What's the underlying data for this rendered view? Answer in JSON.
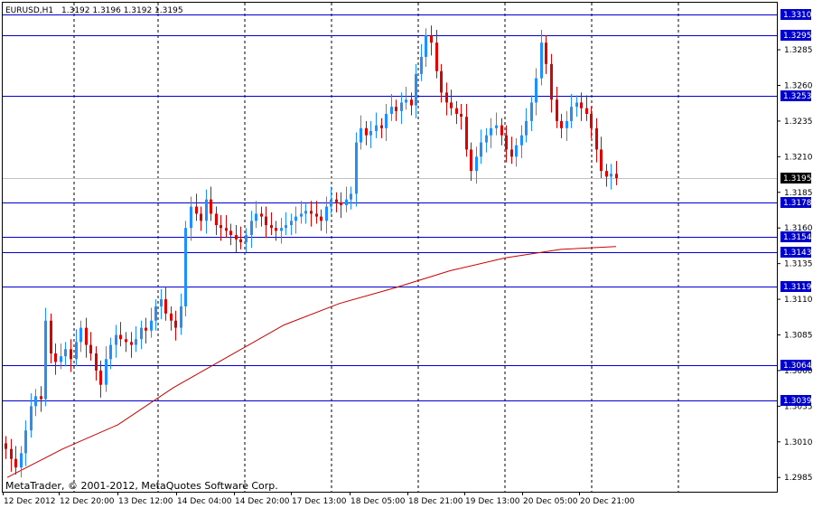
{
  "header": {
    "symbol": "EURUSD,H1",
    "ohlc": "1.3192 1.3196 1.3192 1.3195"
  },
  "watermark": "MetaTrader, © 2001-2012, MetaQuotes Software Corp.",
  "colors": {
    "background": "#ffffff",
    "frame": "#000000",
    "bull_candle": "#1e90ff",
    "bear_candle": "#e00000",
    "hline": "#0000cc",
    "moving_average": "#cc0000",
    "grid_vertical": "#000000",
    "current_price_line": "#c0c0c0",
    "current_price_tag": "#000000"
  },
  "chart_data": {
    "type": "candlestick",
    "symbol": "EURUSD",
    "timeframe": "H1",
    "ylim": [
      1.2975,
      1.3318
    ],
    "yticks": [
      "1.3285",
      "1.3260",
      "1.3235",
      "1.3210",
      "1.3185",
      "1.3160",
      "1.3135",
      "1.3110",
      "1.3085",
      "1.3060",
      "1.3035",
      "1.3010",
      "1.2985"
    ],
    "xticks": [
      "12 Dec 2012",
      "12 Dec 20:00",
      "13 Dec 12:00",
      "14 Dec 04:00",
      "14 Dec 20:00",
      "17 Dec 13:00",
      "18 Dec 05:00",
      "18 Dec 21:00",
      "19 Dec 13:00",
      "20 Dec 05:00",
      "20 Dec 21:00"
    ],
    "horizontal_levels": [
      1.331,
      1.3295,
      1.3253,
      1.3178,
      1.3154,
      1.3143,
      1.3119,
      1.3064,
      1.3039
    ],
    "horizontal_level_labels": [
      "1.3310",
      "1.3295",
      "1.3253",
      "1.3178",
      "1.3154",
      "1.3143",
      "1.3119",
      "1.3064",
      "1.3039"
    ],
    "current_price": 1.3195,
    "current_price_label": "1.3195",
    "close_series": [
      1.3005,
      1.2998,
      1.2992,
      1.3002,
      1.3018,
      1.3035,
      1.3042,
      1.304,
      1.3095,
      1.3072,
      1.3066,
      1.307,
      1.3075,
      1.3068,
      1.308,
      1.309,
      1.3078,
      1.3072,
      1.306,
      1.305,
      1.3068,
      1.3078,
      1.3085,
      1.3082,
      1.308,
      1.3078,
      1.3082,
      1.309,
      1.3088,
      1.3095,
      1.3105,
      1.311,
      1.31,
      1.3095,
      1.309,
      1.3105,
      1.316,
      1.3175,
      1.317,
      1.3165,
      1.318,
      1.317,
      1.3162,
      1.316,
      1.3158,
      1.3155,
      1.3152,
      1.315,
      1.3155,
      1.3165,
      1.317,
      1.3168,
      1.3162,
      1.316,
      1.3158,
      1.316,
      1.3162,
      1.3165,
      1.3168,
      1.317,
      1.3172,
      1.317,
      1.3168,
      1.3165,
      1.3175,
      1.318,
      1.3178,
      1.3176,
      1.318,
      1.3184,
      1.322,
      1.323,
      1.3225,
      1.3228,
      1.3232,
      1.323,
      1.324,
      1.3245,
      1.3242,
      1.3248,
      1.325,
      1.3246,
      1.3268,
      1.328,
      1.3295,
      1.329,
      1.327,
      1.3255,
      1.3248,
      1.3244,
      1.324,
      1.3238,
      1.3215,
      1.32,
      1.321,
      1.322,
      1.3225,
      1.323,
      1.3232,
      1.3225,
      1.3215,
      1.321,
      1.3218,
      1.3225,
      1.3235,
      1.3248,
      1.3265,
      1.329,
      1.3275,
      1.325,
      1.3235,
      1.323,
      1.3235,
      1.3245,
      1.3248,
      1.3244,
      1.324,
      1.323,
      1.3215,
      1.32,
      1.3196,
      1.3198,
      1.3195
    ],
    "moving_average": [
      1.2985,
      1.3005,
      1.3022,
      1.3048,
      1.307,
      1.3092,
      1.3107,
      1.3118,
      1.313,
      1.3139,
      1.3145,
      1.3147
    ]
  }
}
